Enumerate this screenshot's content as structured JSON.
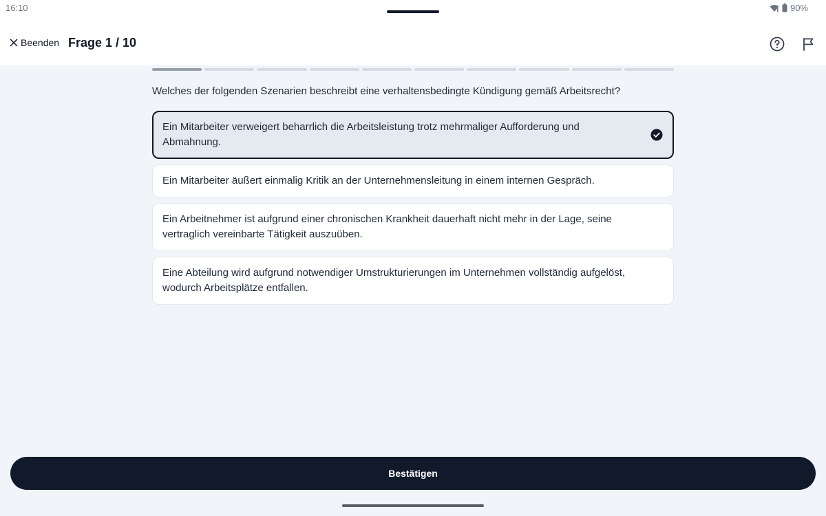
{
  "status": {
    "time": "16:10",
    "battery": "90%"
  },
  "header": {
    "quit_label": "Beenden",
    "title": "Frage 1 / 10"
  },
  "progress": {
    "current": 1,
    "total": 10
  },
  "question": "Welches der folgenden Szenarien beschreibt eine verhaltensbedingte Kündigung gemäß Arbeitsrecht?",
  "options": [
    {
      "text": "Ein Mitarbeiter verweigert beharrlich die Arbeitsleistung trotz mehrmaliger Aufforderung und Abmahnung.",
      "selected": true
    },
    {
      "text": "Ein Mitarbeiter äußert einmalig Kritik an der Unternehmensleitung in einem internen Gespräch.",
      "selected": false
    },
    {
      "text": "Ein Arbeitnehmer ist aufgrund einer chronischen Krankheit dauerhaft nicht mehr in der Lage, seine vertraglich vereinbarte Tätigkeit auszuüben.",
      "selected": false
    },
    {
      "text": "Eine Abteilung wird aufgrund notwendiger Umstrukturierungen im Unternehmen vollständig aufgelöst, wodurch Arbeitsplätze entfallen.",
      "selected": false
    }
  ],
  "confirm_label": "Bestätigen",
  "colors": {
    "primary": "#111a2b",
    "background": "#f1f4f8",
    "selected_bg": "#e5e9f0"
  },
  "icons": {
    "quit": "close-icon",
    "help": "help-circle-icon",
    "flag": "flag-icon",
    "check": "check-circle-icon",
    "wifi": "wifi-icon",
    "battery": "battery-icon"
  }
}
